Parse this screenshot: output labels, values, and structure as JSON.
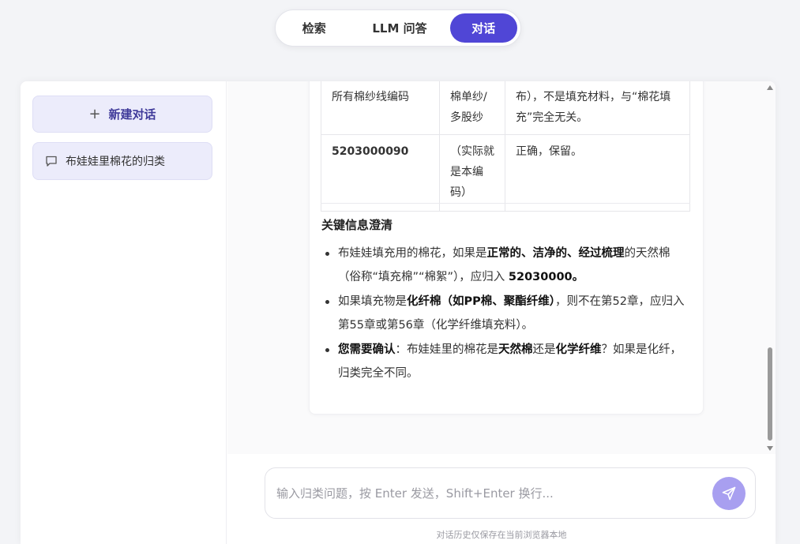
{
  "modes": {
    "tabs": [
      {
        "label": "检索"
      },
      {
        "label": "LLM 问答"
      },
      {
        "label": "对话"
      }
    ],
    "active": "对话"
  },
  "sidebar": {
    "new_chat_label": "新建对话",
    "conversations": [
      {
        "title": "布娃娃里棉花的归类"
      }
    ]
  },
  "message": {
    "table": {
      "rows": [
        {
          "code": "所有棉纱线编码",
          "type": "棉单纱/多股纱",
          "note": "布），不是填充材料，与“棉花填充”完全无关。"
        },
        {
          "code": "5203000090",
          "type": "（实际就是本编码）",
          "note": "正确，保留。"
        }
      ]
    },
    "section_title": "关键信息澄清",
    "points": {
      "p1": {
        "a": "布娃娃填充用的棉花，如果是",
        "b": "正常的、洁净的、经过梳理",
        "c": "的天然棉（俗称“填充棉”“棉絮”），应归入 ",
        "d": "52030000。"
      },
      "p2": {
        "a": "如果填充物是",
        "b": "化纤棉（如PP棉、聚酯纤维）",
        "c": "，则不在第52章，应归入第55章或第56章（化学纤维填充料）。"
      },
      "p3": {
        "a": "您需要确认",
        "b": "：布娃娃里的棉花是",
        "c": "天然棉",
        "d": "还是",
        "e": "化学纤维",
        "f": "？如果是化纤，归类完全不同。"
      }
    }
  },
  "input": {
    "placeholder": "输入归类问题，按 Enter 发送，Shift+Enter 换行...",
    "value": ""
  },
  "footnote": "对话历史仅保存在当前浏览器本地",
  "colors": {
    "accent": "#5046d6",
    "accent_light": "#ececfb",
    "send_button": "#a89ff0"
  },
  "icons": {
    "new_chat": "plus-icon",
    "conversation": "chat-bubble-icon",
    "send": "send-icon"
  }
}
